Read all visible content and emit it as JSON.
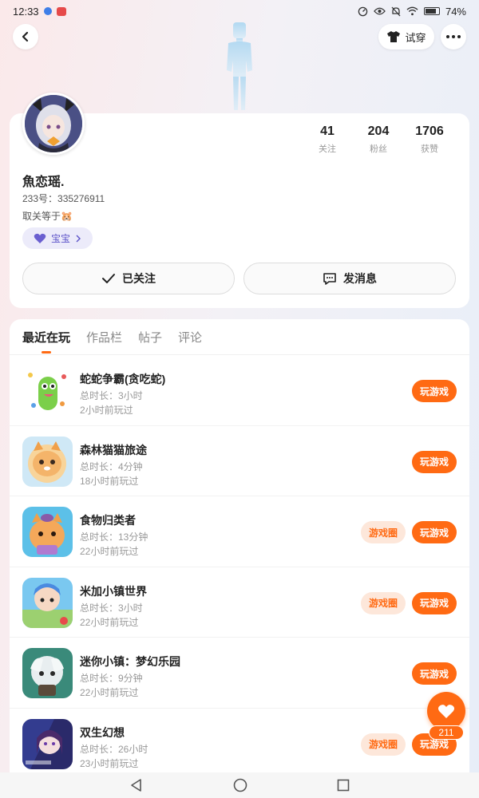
{
  "status_bar": {
    "time": "12:33",
    "battery": "74%"
  },
  "header": {
    "try_on_label": "试穿"
  },
  "profile": {
    "nickname": "魚恋瑶.",
    "uid": "233号：335276911",
    "bio": "取关等于🐹",
    "tag": "宝宝",
    "stats": [
      {
        "value": "41",
        "label": "关注"
      },
      {
        "value": "204",
        "label": "粉丝"
      },
      {
        "value": "1706",
        "label": "获赞"
      }
    ],
    "follow_label": "已关注",
    "message_label": "发消息"
  },
  "tabs": [
    "最近在玩",
    "作品栏",
    "帖子",
    "评论"
  ],
  "games": [
    {
      "name": "蛇蛇争霸(贪吃蛇)",
      "duration": "总时长：3小时",
      "last": "2小时前玩过",
      "circle": "",
      "play": "玩游戏"
    },
    {
      "name": "森林猫猫旅途",
      "duration": "总时长：4分钟",
      "last": "18小时前玩过",
      "circle": "",
      "play": "玩游戏"
    },
    {
      "name": "食物归类者",
      "duration": "总时长：13分钟",
      "last": "22小时前玩过",
      "circle": "游戏圈",
      "play": "玩游戏"
    },
    {
      "name": "米加小镇世界",
      "duration": "总时长：3小时",
      "last": "22小时前玩过",
      "circle": "游戏圈",
      "play": "玩游戏"
    },
    {
      "name": "迷你小镇：梦幻乐园",
      "duration": "总时长：9分钟",
      "last": "22小时前玩过",
      "circle": "",
      "play": "玩游戏"
    },
    {
      "name": "双生幻想",
      "duration": "总时长：26小时",
      "last": "23小时前玩过",
      "circle": "游戏圈",
      "play": "玩游戏"
    }
  ],
  "like_fab": {
    "count": "211"
  },
  "colors": {
    "accent": "#ff6a13",
    "tag_purple": "#5b52c8"
  }
}
